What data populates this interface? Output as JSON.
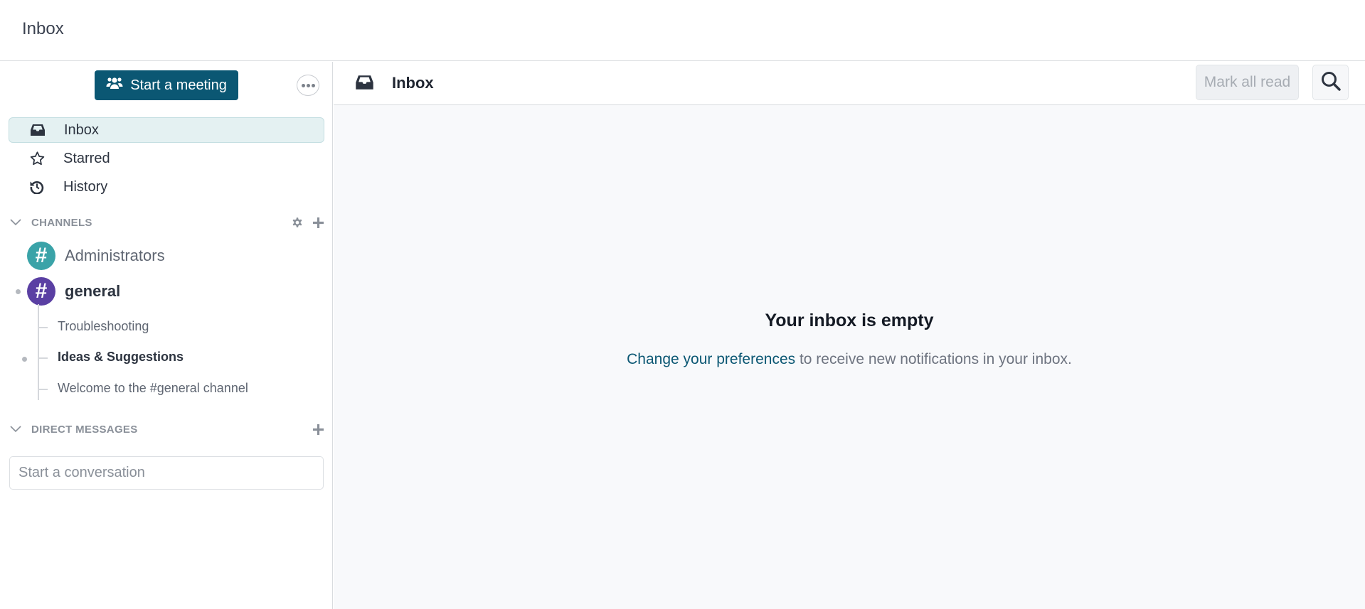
{
  "topbar": {
    "title": "Inbox"
  },
  "sidebar": {
    "meeting_button": "Start a meeting",
    "nav": [
      {
        "label": "Inbox",
        "icon": "inbox-icon",
        "active": true
      },
      {
        "label": "Starred",
        "icon": "star-icon",
        "active": false
      },
      {
        "label": "History",
        "icon": "history-icon",
        "active": false
      }
    ],
    "channels_header": "CHANNELS",
    "channels": [
      {
        "name": "Administrators",
        "color": "#3aa3a8",
        "bold": false,
        "unread": false
      },
      {
        "name": "general",
        "color": "#5a3fa3",
        "bold": true,
        "unread": true
      }
    ],
    "threads": [
      {
        "name": "Troubleshooting",
        "bold": false,
        "unread": false
      },
      {
        "name": "Ideas & Suggestions",
        "bold": true,
        "unread": true
      },
      {
        "name": "Welcome to the #general channel",
        "bold": false,
        "unread": false
      }
    ],
    "dm_header": "DIRECT MESSAGES",
    "dm_placeholder": "Start a conversation"
  },
  "main": {
    "title": "Inbox",
    "mark_all_read": "Mark all read",
    "empty_title": "Your inbox is empty",
    "empty_link": "Change your preferences",
    "empty_text": " to receive new notifications in your inbox."
  },
  "colors": {
    "accent": "#0b5773",
    "active_bg": "#e4f1f2"
  }
}
